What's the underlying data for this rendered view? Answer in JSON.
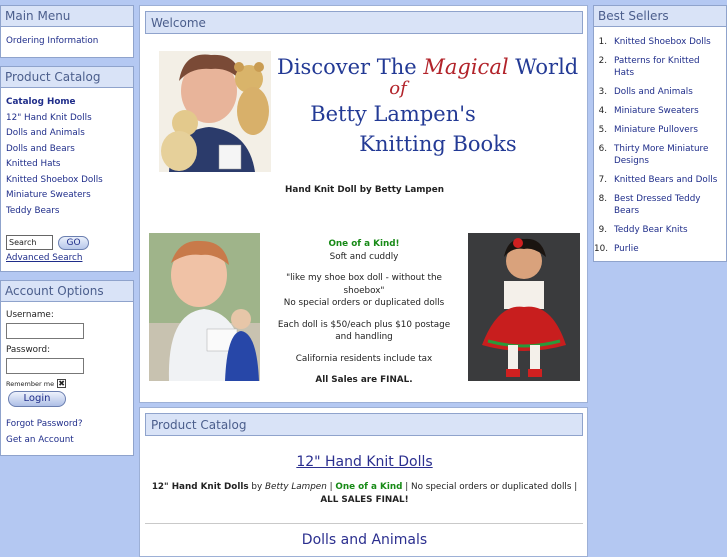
{
  "main_menu": {
    "title": "Main Menu",
    "items": [
      "Ordering Information"
    ]
  },
  "product_catalog_menu": {
    "title": "Product Catalog",
    "items": [
      "Catalog Home",
      "12\" Hand Knit Dolls",
      "Dolls and Animals",
      "Dolls and Bears",
      "Knitted Hats",
      "Knitted Shoebox Dolls",
      "Miniature Sweaters",
      "Teddy Bears"
    ],
    "search_value": "Search",
    "go_label": "GO",
    "advanced_search": "Advanced Search"
  },
  "account": {
    "title": "Account Options",
    "username_label": "Username:",
    "password_label": "Password:",
    "remember_label": "Remember me",
    "login_label": "Login",
    "forgot": "Forgot Password?",
    "get_account": "Get an Account"
  },
  "best_sellers": {
    "title": "Best Sellers",
    "items": [
      "Knitted Shoebox Dolls",
      "Patterns for Knitted Hats",
      "Dolls and Animals",
      "Miniature Sweaters",
      "Miniature Pullovers",
      "Thirty More Miniature Designs",
      "Knitted Bears and Dolls",
      "Best Dressed Teddy Bears",
      "Teddy Bear Knits",
      "Purlie"
    ]
  },
  "welcome": {
    "title": "Welcome",
    "banner": {
      "line1a": "Discover The ",
      "line1b": "Magical",
      "line1c": " World",
      "line2": "of",
      "line3": "Betty Lampen's",
      "line4": "Knitting Books"
    },
    "caption": "Hand Knit Doll by Betty Lampen",
    "one_of_kind": "One of a Kind!",
    "soft": "Soft and cuddly",
    "quote1": "\"like my shoe box doll - without the shoebox\"",
    "quote2": "No special orders or duplicated dolls",
    "price": "Each doll is $50/each plus $10 postage and handling",
    "tax": "California residents include tax",
    "final": "All Sales are FINAL."
  },
  "catalog": {
    "title": "Product Catalog",
    "section1": "12\" Hand Knit Dolls",
    "s1_name": "12\" Hand Knit Dolls",
    "s1_by": " by ",
    "s1_author": "Betty Lampen",
    "s1_sep1": " | ",
    "s1_one": "One of a Kind",
    "s1_sep2": " | No special orders or duplicated dolls | ",
    "s1_final": "ALL SALES FINAL!",
    "section2": "Dolls and Animals"
  }
}
